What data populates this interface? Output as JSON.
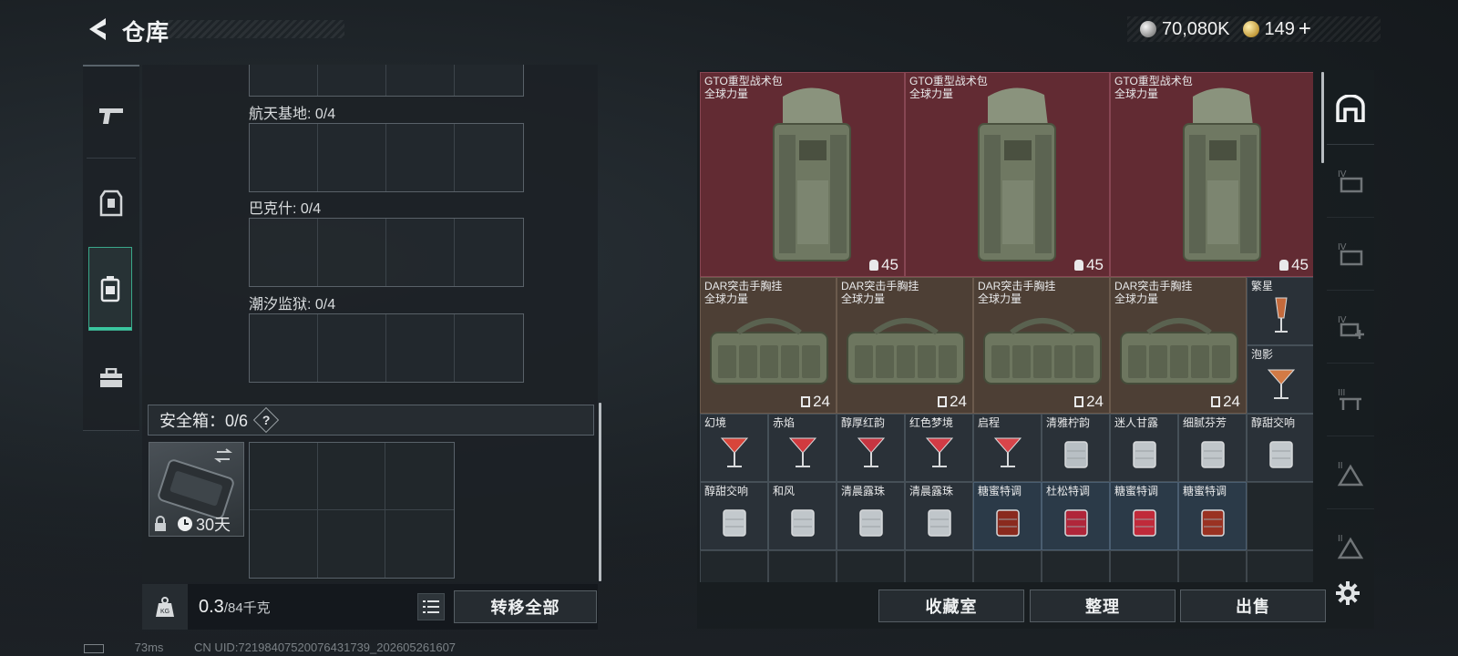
{
  "header": {
    "title": "仓库",
    "currency_silver": "70,080K",
    "currency_gold": "149",
    "add_label": "+"
  },
  "left_nav": [
    "gun-icon",
    "armor-icon",
    "backpack-icon",
    "toolbox-icon"
  ],
  "locations": [
    {
      "label": "航天基地: 0/4"
    },
    {
      "label": "巴克什: 0/4"
    },
    {
      "label": "潮汐监狱: 0/4"
    }
  ],
  "safe_box": {
    "label": "安全箱：0/6",
    "help": "?",
    "duration": "30天"
  },
  "weight": {
    "current": "0.3",
    "max": "/84千克"
  },
  "buttons": {
    "transfer_all": "转移全部",
    "collection": "收藏室",
    "organize": "整理",
    "sell": "出售"
  },
  "items": {
    "backpacks": [
      {
        "name": "GTO重型战术包",
        "sub": "全球力量",
        "count": "45"
      },
      {
        "name": "GTO重型战术包",
        "sub": "全球力量",
        "count": "45"
      },
      {
        "name": "GTO重型战术包",
        "sub": "全球力量",
        "count": "45"
      }
    ],
    "vests": [
      {
        "name": "DAR突击手胸挂",
        "sub": "全球力量",
        "count": "24"
      },
      {
        "name": "DAR突击手胸挂",
        "sub": "全球力量",
        "count": "24"
      },
      {
        "name": "DAR突击手胸挂",
        "sub": "全球力量",
        "count": "24"
      },
      {
        "name": "DAR突击手胸挂",
        "sub": "全球力量",
        "count": "24"
      }
    ],
    "side_drinks": [
      {
        "name": "繁星"
      },
      {
        "name": "泡影"
      }
    ],
    "drinks_row1": [
      {
        "name": "幻境"
      },
      {
        "name": "赤焰"
      },
      {
        "name": "醇厚红韵"
      },
      {
        "name": "红色梦境"
      },
      {
        "name": "启程"
      },
      {
        "name": "清雅柠韵"
      },
      {
        "name": "迷人甘露"
      },
      {
        "name": "细腻芬芳"
      },
      {
        "name": "醇甜交响"
      }
    ],
    "drinks_row2": [
      {
        "name": "醇甜交响"
      },
      {
        "name": "和风"
      },
      {
        "name": "清晨露珠"
      },
      {
        "name": "清晨露珠"
      },
      {
        "name": "糖蜜特调"
      },
      {
        "name": "杜松特调"
      },
      {
        "name": "糖蜜特调"
      },
      {
        "name": "糖蜜特调"
      }
    ]
  },
  "status": {
    "ping": "73ms",
    "uid": "CN UID:7219840752007643173​9_202605261607"
  }
}
